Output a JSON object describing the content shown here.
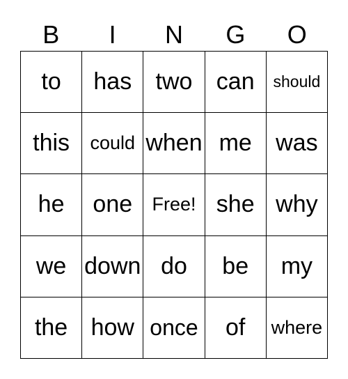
{
  "header": [
    "B",
    "I",
    "N",
    "G",
    "O"
  ],
  "cells": [
    [
      "to",
      "has",
      "two",
      "can",
      "should"
    ],
    [
      "this",
      "could",
      "when",
      "me",
      "was"
    ],
    [
      "he",
      "one",
      "Free!",
      "she",
      "why"
    ],
    [
      "we",
      "down",
      "do",
      "be",
      "my"
    ],
    [
      "the",
      "how",
      "once",
      "of",
      "where"
    ]
  ]
}
